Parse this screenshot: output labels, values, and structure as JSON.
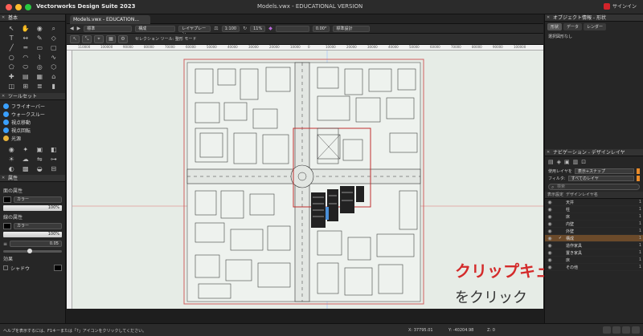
{
  "app": {
    "title": "Vectorworks Design Suite 2023",
    "document_title": "Models.vwx - EDUCATIONAL VERSION",
    "signin_label": "サインイン"
  },
  "tabs": {
    "document_tab": "Models.vwx - EDUCATION..."
  },
  "left_palettes": {
    "basic_title": "基本",
    "toolset_title": "ツールセット",
    "toolset_items": [
      "フライオーバー",
      "ウォークスルー",
      "視点移動",
      "視点回転",
      "光源"
    ],
    "attributes_title": "属性",
    "fill_label": "面の属性",
    "fill_color": "カラー",
    "fill_opacity": "100%",
    "line_label": "線の属性",
    "line_color": "カラー",
    "line_opacity": "100%",
    "line_weight": "0.05",
    "effects_label": "効果",
    "shadow_label": "シャドウ"
  },
  "viewbar": {
    "class_value": "標準",
    "layer_value": "構成",
    "layer_plane": "レイヤプレーン",
    "scale": "1:100",
    "zoom": "11%",
    "angle": "0.00°",
    "view": "標準設計"
  },
  "modebar": {
    "mode_label": "セレクション ツール: 整形 モード"
  },
  "canvas": {
    "ruler_ticks": [
      "110000",
      "100000",
      "90000",
      "80000",
      "70000",
      "60000",
      "50000",
      "40000",
      "30000",
      "20000",
      "10000",
      "0",
      "10000",
      "20000",
      "30000",
      "40000",
      "50000",
      "60000",
      "70000",
      "80000",
      "90000",
      "100000"
    ]
  },
  "right_palettes": {
    "object_info_title": "オブジェクト情報 - 形状",
    "oi_tabs": [
      "形状",
      "データ",
      "レンダー"
    ],
    "oi_selection": "選択図形なし",
    "nav_title": "ナビゲーション - デザインレイヤ",
    "active_layer_label": "使用レイヤを",
    "active_layer_value": "表示+スナップ",
    "filter_label": "フィルタ:",
    "filter_value": "すべてのレイヤ",
    "search_placeholder": "検索",
    "col_visibility": "表示設定",
    "col_name": "デザインレイヤ名",
    "layers": [
      {
        "name": "天井",
        "num": "1",
        "active": false,
        "check": ""
      },
      {
        "name": "柱",
        "num": "1",
        "active": false,
        "check": ""
      },
      {
        "name": "床",
        "num": "1",
        "active": false,
        "check": ""
      },
      {
        "name": "内壁",
        "num": "1",
        "active": false,
        "check": ""
      },
      {
        "name": "外壁",
        "num": "1",
        "active": false,
        "check": ""
      },
      {
        "name": "構成",
        "num": "1",
        "active": true,
        "check": "✓"
      },
      {
        "name": "造作家具",
        "num": "1",
        "active": false,
        "check": ""
      },
      {
        "name": "置き家具",
        "num": "1",
        "active": false,
        "check": ""
      },
      {
        "name": "床",
        "num": "1",
        "active": false,
        "check": ""
      },
      {
        "name": "その他",
        "num": "1",
        "active": false,
        "check": ""
      }
    ]
  },
  "statusbar": {
    "help": "ヘルプを表示するには、F1キーまたは「?」アイコンをクリックしてください。",
    "x": "X: 37795.01",
    "y": "Y: -40204.98",
    "z": "Z: 0"
  },
  "annotation": {
    "line1": "クリップキューブ",
    "line2": "をクリック",
    "tooltip": "構成"
  },
  "colors": {
    "accent_red": "#d42b2b",
    "active_layer": "#6b4a2a",
    "canvas_bg": "#e6ece6"
  }
}
